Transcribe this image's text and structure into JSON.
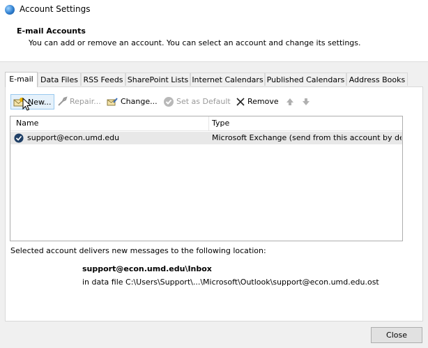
{
  "window": {
    "title": "Account Settings",
    "icon": "outlook-globe-icon"
  },
  "header": {
    "title": "E-mail Accounts",
    "description": "You can add or remove an account. You can select an account and change its settings."
  },
  "tabs": [
    {
      "label": "E-mail",
      "active": true
    },
    {
      "label": "Data Files"
    },
    {
      "label": "RSS Feeds"
    },
    {
      "label": "SharePoint Lists"
    },
    {
      "label": "Internet Calendars"
    },
    {
      "label": "Published Calendars"
    },
    {
      "label": "Address Books"
    }
  ],
  "toolbar": {
    "new": "New...",
    "repair": "Repair...",
    "change": "Change...",
    "set_default": "Set as Default",
    "remove": "Remove"
  },
  "list": {
    "columns": [
      "Name",
      "Type"
    ],
    "rows": [
      {
        "name": "support@econ.umd.edu",
        "type": "Microsoft Exchange (send from this account by def..."
      }
    ]
  },
  "delivery": {
    "label": "Selected account delivers new messages to the following location:",
    "location": "support@econ.umd.edu\\Inbox",
    "file": "in data file C:\\Users\\Support\\...\\Microsoft\\Outlook\\support@econ.umd.edu.ost"
  },
  "footer": {
    "close": "Close"
  },
  "colors": {
    "selected_row": "#e8e8e8",
    "new_button_bg": "#e5f1fb",
    "new_button_border": "#99c9ef"
  }
}
